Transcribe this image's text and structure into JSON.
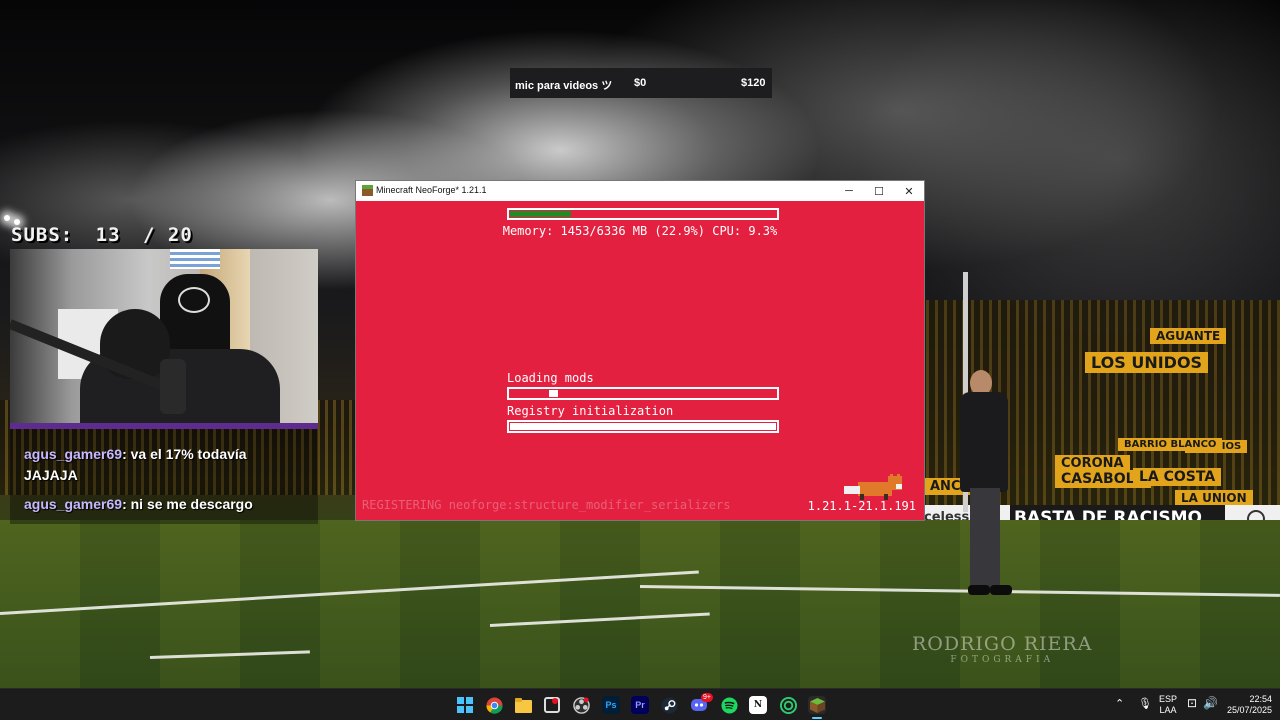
{
  "donation_goal": {
    "label": "mic para videos ツ",
    "current": "$0",
    "target": "$120"
  },
  "subs_counter": {
    "label": "SUBS:",
    "current": "13",
    "separator": "/",
    "goal": "20"
  },
  "chat": {
    "messages": [
      {
        "user": "agus_gamer69",
        "text": ": va el 17% todavía"
      },
      {
        "user": "",
        "text": "JAJAJA"
      },
      {
        "user": "agus_gamer69",
        "text": ": ni se me descargo"
      }
    ]
  },
  "minecraft_window": {
    "title": "Minecraft NeoForge* 1.21.1",
    "controls": {
      "minimize": "─",
      "maximize": "☐",
      "close": "✕"
    },
    "memory_text": "Memory: 1453/6336 MB (22.9%)  CPU: 9.3%",
    "memory_fraction": 0.229,
    "progress": [
      {
        "label": "Loading mods",
        "fraction": 0.15,
        "style": "marker"
      },
      {
        "label": "Registry initialization",
        "fraction": 1.0,
        "style": "fill"
      }
    ],
    "status_text": "REGISTERING neoforge:structure_modifier_serializers",
    "version": "1.21.1-21.1.191",
    "colors": {
      "background": "#e32040",
      "memory_fill": "#1f8a26"
    }
  },
  "wallpaper": {
    "ad_board_text": "BASTA DE RACISMO",
    "ad_partial": "celess",
    "banners": [
      "LOS UNIDOS",
      "AGUANTE",
      "CORONA",
      "CASABOLA",
      "LA COSTA",
      "BARRIOS",
      "BARRIO BLANCO",
      "ANCA",
      "LA UNION"
    ],
    "watermark_title": "RODRIGO RIERA",
    "watermark_sub": "FOTOGRAFIA"
  },
  "taskbar": {
    "apps": [
      {
        "name": "start-icon",
        "label": ""
      },
      {
        "name": "chrome-icon",
        "label": ""
      },
      {
        "name": "file-explorer-icon",
        "label": ""
      },
      {
        "name": "snipping-tool-icon",
        "label": ""
      },
      {
        "name": "obs-icon",
        "label": ""
      },
      {
        "name": "photoshop-icon",
        "label": "Ps"
      },
      {
        "name": "premiere-icon",
        "label": "Pr"
      },
      {
        "name": "steam-icon",
        "label": ""
      },
      {
        "name": "discord-icon",
        "label": ""
      },
      {
        "name": "spotify-icon",
        "label": ""
      },
      {
        "name": "notion-icon",
        "label": "N"
      },
      {
        "name": "app-icon",
        "label": ""
      },
      {
        "name": "minecraft-icon",
        "label": ""
      }
    ],
    "discord_badge": "9+",
    "tray": {
      "language_top": "ESP",
      "language_bottom": "LAA",
      "time": "22:54",
      "date": "25/07/2025"
    }
  }
}
